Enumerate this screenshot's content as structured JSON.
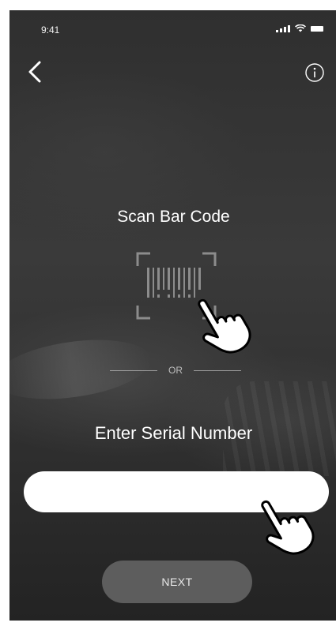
{
  "status_bar": {
    "time": "9:41"
  },
  "scan": {
    "title": "Scan Bar Code"
  },
  "divider": {
    "text": "OR"
  },
  "serial": {
    "title": "Enter Serial Number",
    "value": "",
    "placeholder": ""
  },
  "actions": {
    "next_label": "NEXT"
  },
  "colors": {
    "background": "#333333",
    "text": "#ffffff",
    "input_bg": "#ffffff",
    "button_bg": "#5d5d5d"
  },
  "icons": [
    "back-chevron-icon",
    "info-icon",
    "barcode-scan-icon",
    "tap-hand-icon"
  ]
}
